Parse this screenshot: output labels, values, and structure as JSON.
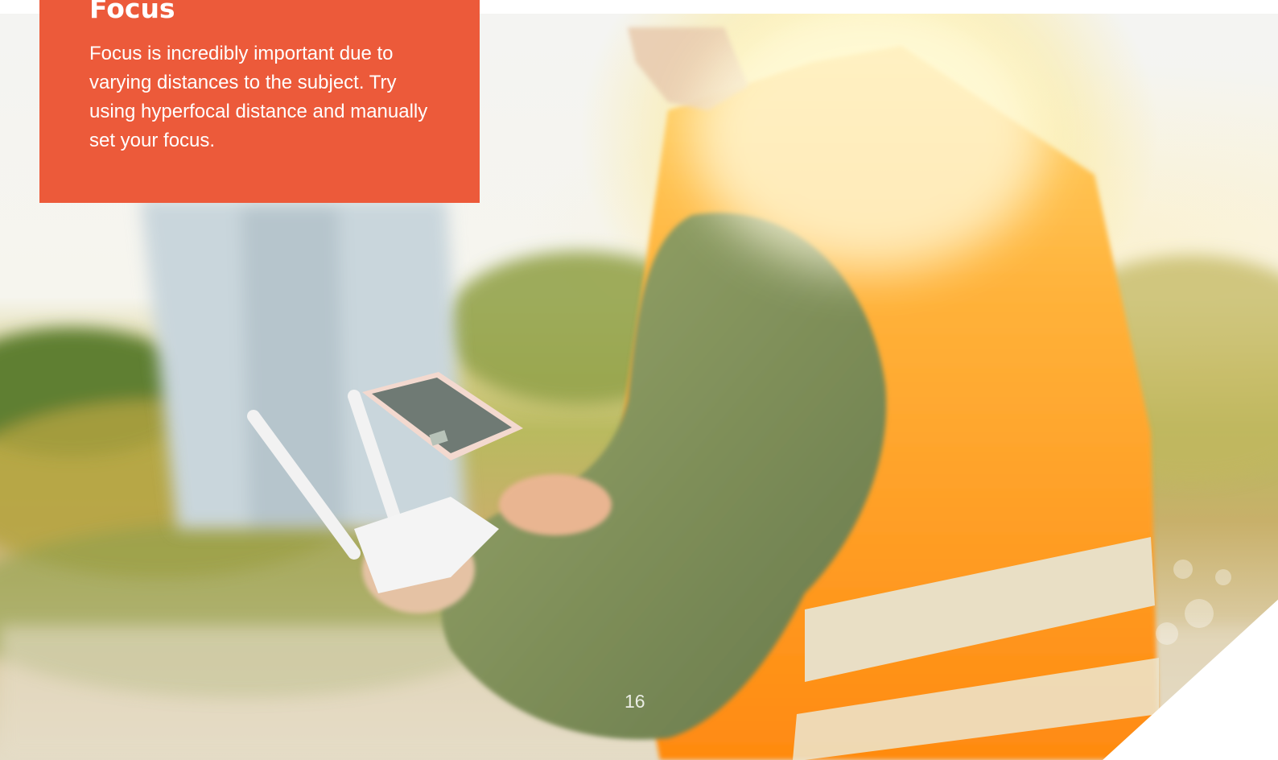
{
  "callout": {
    "title": "Focus",
    "body": "Focus is incredibly important due to varying distances to the subject. Try using hyperfocal distance and manually set your focus.",
    "background_color": "#ec5a3a",
    "text_color": "#ffffff"
  },
  "page": {
    "number": "16"
  }
}
